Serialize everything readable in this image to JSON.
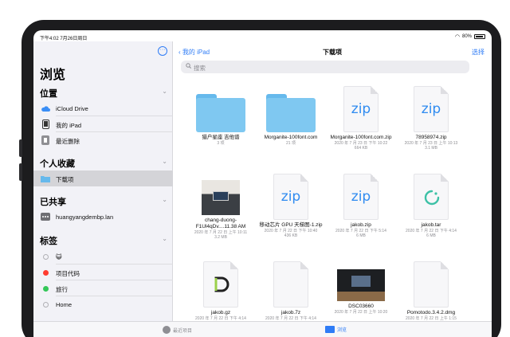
{
  "status": {
    "time": "下午4:02  7月26日周日",
    "battery": "80%"
  },
  "sidebar": {
    "title": "浏览",
    "sections": {
      "locations": {
        "label": "位置",
        "items": [
          {
            "label": "iCloud Drive",
            "icon": "cloud-icon"
          },
          {
            "label": "我的 iPad",
            "icon": "ipad-icon"
          },
          {
            "label": "最近删除",
            "icon": "trash-icon"
          }
        ]
      },
      "favorites": {
        "label": "个人收藏",
        "items": [
          {
            "label": "下载项",
            "icon": "folder-icon",
            "selected": true
          }
        ]
      },
      "shared": {
        "label": "已共享",
        "items": [
          {
            "label": "huangyangdembp.lan",
            "icon": "server-icon"
          }
        ]
      },
      "tags": {
        "label": "标签",
        "items": [
          {
            "label": "😺",
            "color": "#ffffff"
          },
          {
            "label": "项目代码",
            "color": "#ff3b30"
          },
          {
            "label": "旅行",
            "color": "#34c759"
          },
          {
            "label": "Home",
            "color": "#ffffff"
          }
        ]
      }
    }
  },
  "navbar": {
    "back": "我的 iPad",
    "title": "下载项",
    "select": "选择"
  },
  "search": {
    "placeholder": "搜索"
  },
  "files": [
    {
      "name": "猎户星座 吉他谱",
      "meta": "3 项",
      "kind": "folder"
    },
    {
      "name": "Morganite-100font.com",
      "meta": "21 项",
      "kind": "folder"
    },
    {
      "name": "Morganite-100font.com.zip",
      "meta": "2020 年 7 月 23 日 下午 10:22\n664 KB",
      "kind": "zip"
    },
    {
      "name": "78958974.zip",
      "meta": "2020 年 7 月 23 日 上午 10:13\n3.1 MB",
      "kind": "zip"
    },
    {
      "name": "chang-duong-F1Ul4qDv....11.38 AM",
      "meta": "2020 年 7 月 22 日 上午 10:11\n3.2 MB",
      "kind": "photo"
    },
    {
      "name": "移动芯片 GPU 天梯图-1.zip",
      "meta": "2020 年 7 月 22 日 下午 10:40\n436 KB",
      "kind": "zip"
    },
    {
      "name": "jakob.zip",
      "meta": "2020 年 7 月 22 日 下午 5:14\n6 MB",
      "kind": "zip"
    },
    {
      "name": "jakob.tar",
      "meta": "2020 年 7 月 22 日 下午 4:14\n6 MB",
      "kind": "tar"
    },
    {
      "name": "jakob.gz",
      "meta": "2020 年 7 月 22 日 下午 4:14",
      "kind": "gz"
    },
    {
      "name": "jakob.7z",
      "meta": "2020 年 7 月 22 日 下午 4:14",
      "kind": "blank"
    },
    {
      "name": "DSC03660",
      "meta": "2020 年 7 月 22 日 上午 10:20",
      "kind": "desk"
    },
    {
      "name": "Pomotodo.3.4.2.dmg",
      "meta": "2020 年 7 月 22 日 上午 1:15",
      "kind": "blank"
    }
  ],
  "tabbar": {
    "recent": "最近项目",
    "browse": "浏览"
  },
  "colors": {
    "accent": "#2f7cf6",
    "folder": "#7fc8f1"
  }
}
